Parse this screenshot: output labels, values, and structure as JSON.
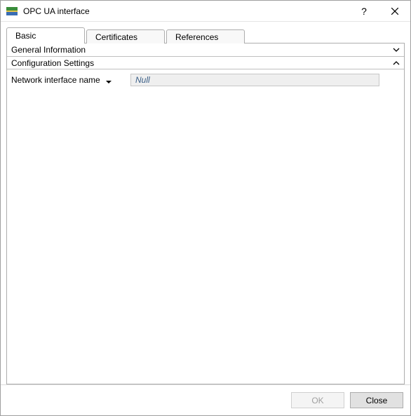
{
  "window": {
    "title": "OPC UA interface"
  },
  "tabs": {
    "basic": "Basic",
    "certificates": "Certificates",
    "references": "References",
    "active": "basic"
  },
  "sections": {
    "general": {
      "label": "General Information",
      "expanded": false
    },
    "config": {
      "label": "Configuration Settings",
      "expanded": true
    }
  },
  "fields": {
    "network_interface_name": {
      "label": "Network interface name",
      "value": "Null"
    }
  },
  "buttons": {
    "ok": "OK",
    "close": "Close"
  }
}
